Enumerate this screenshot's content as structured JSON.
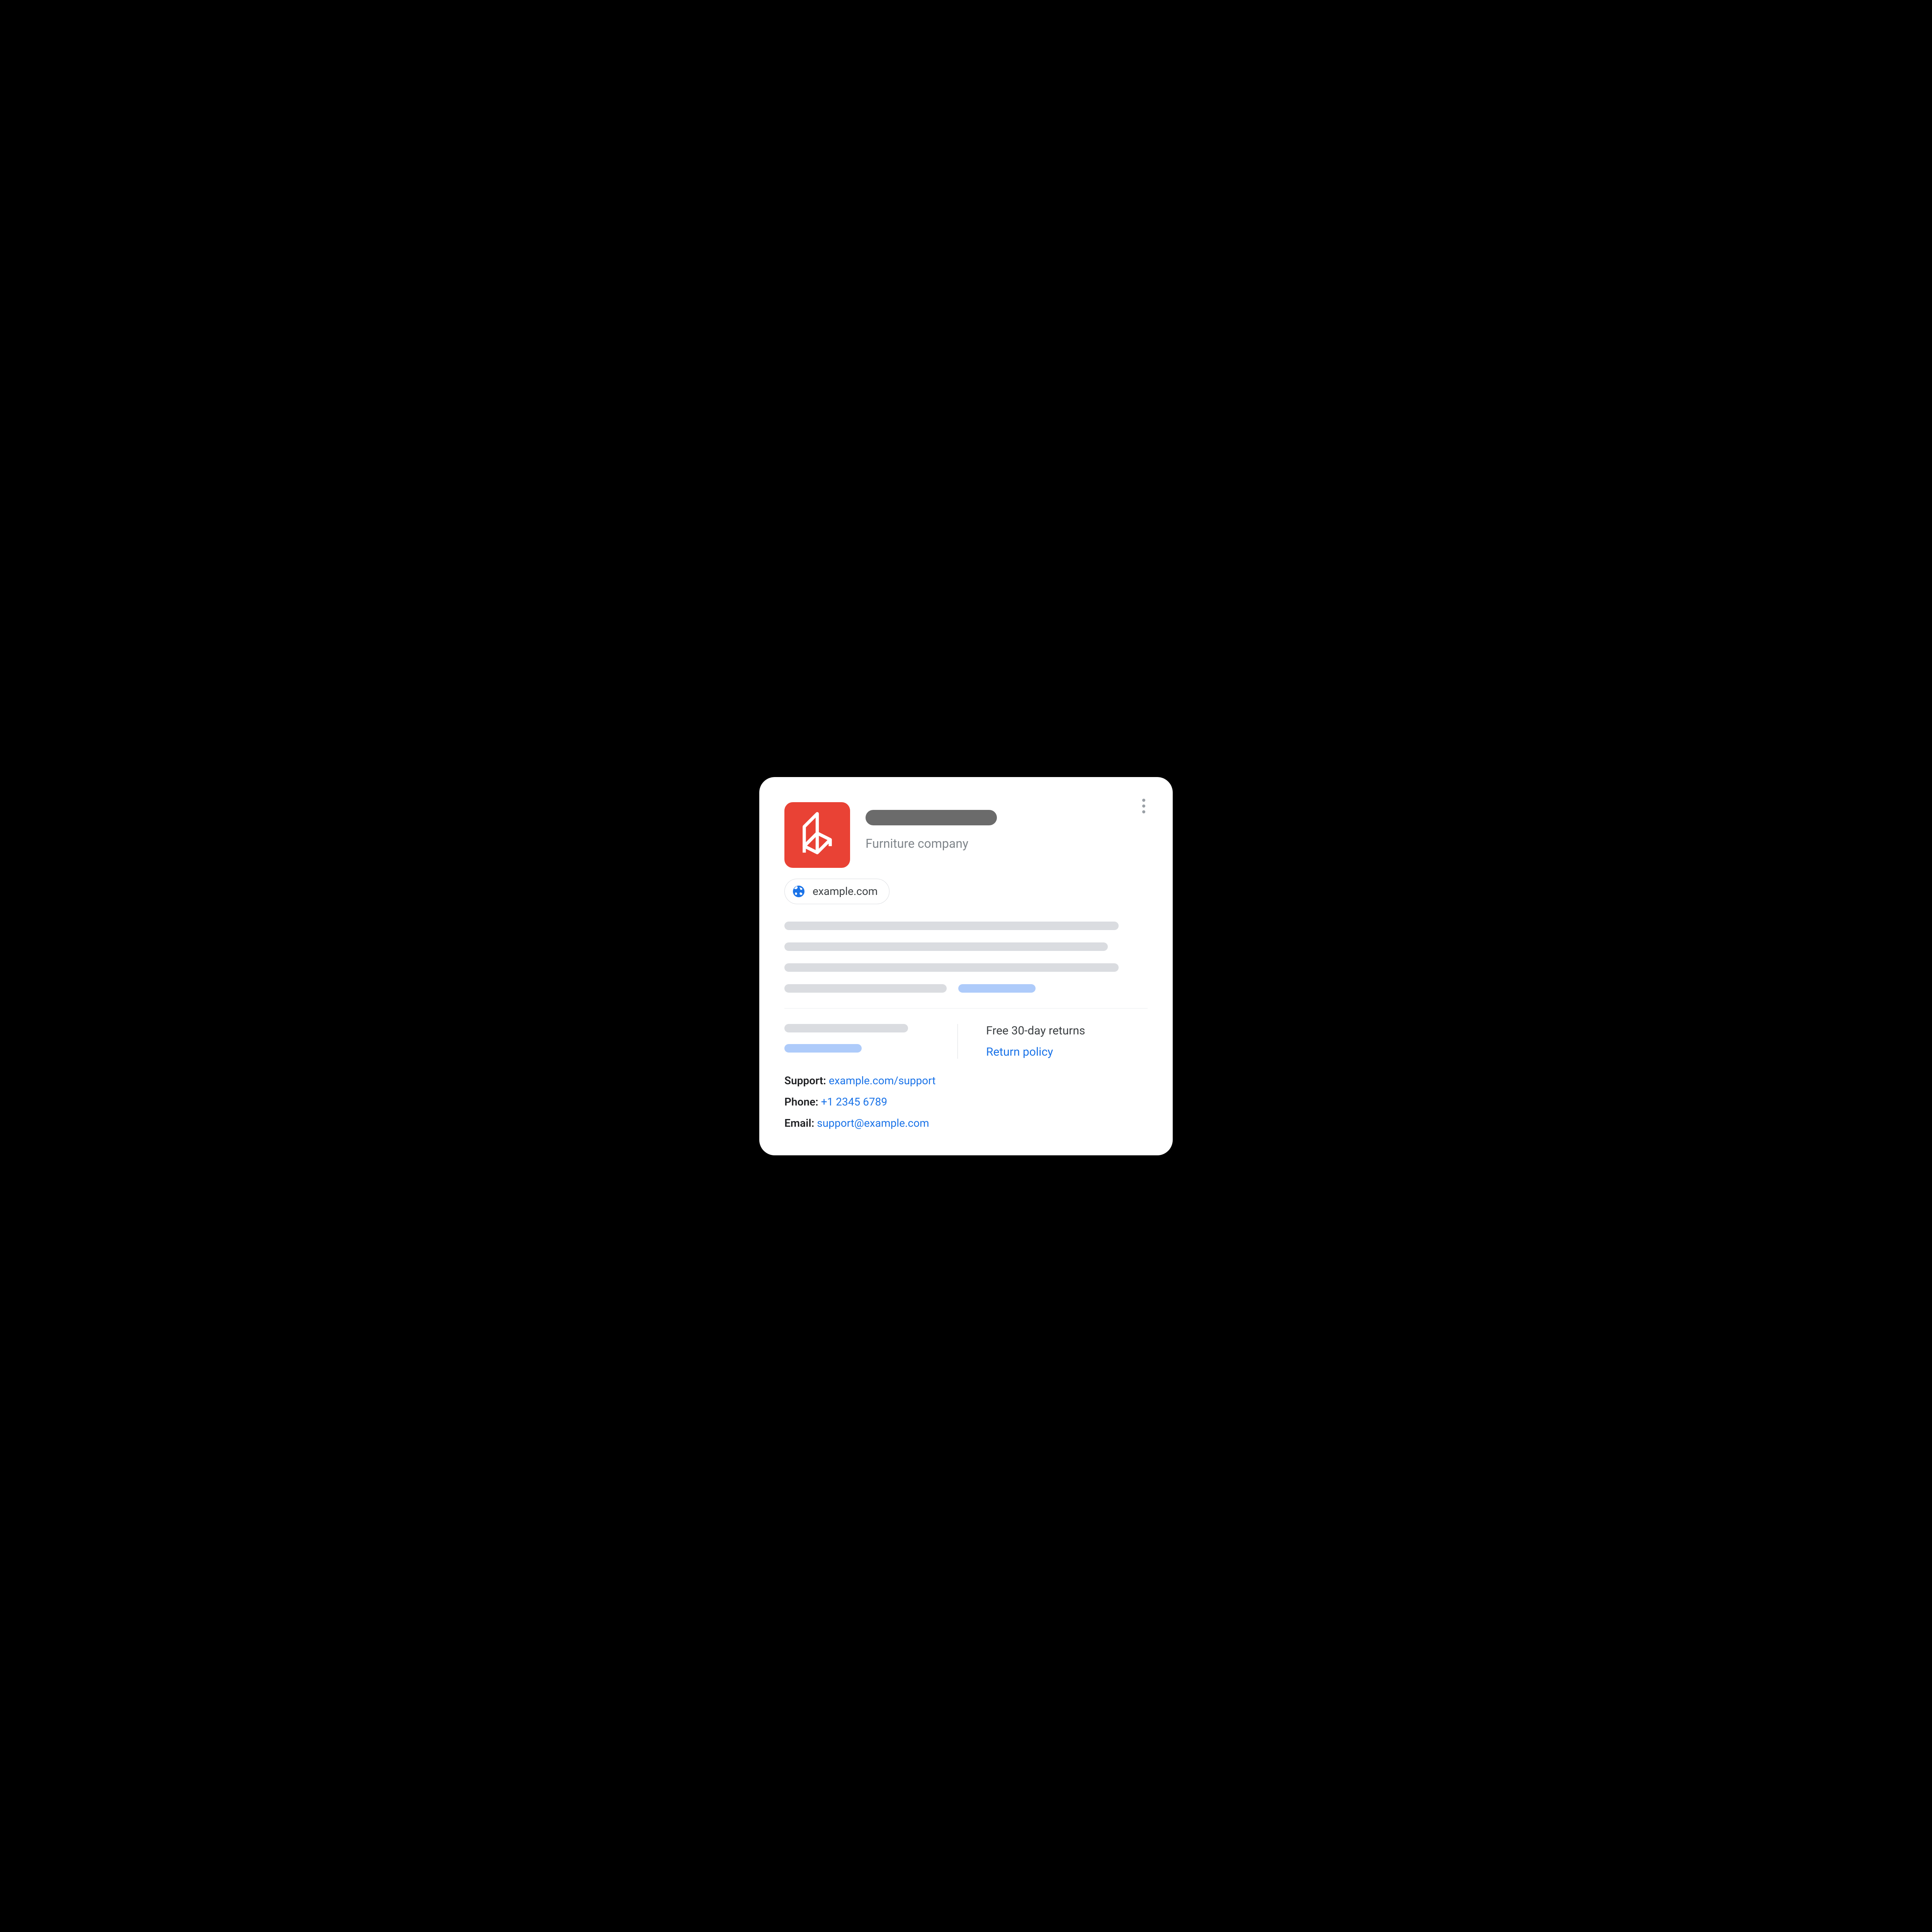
{
  "header": {
    "subtitle": "Furniture company"
  },
  "chip": {
    "domain": "example.com"
  },
  "returns": {
    "line": "Free 30-day returns",
    "policy_link": "Return policy"
  },
  "contact": {
    "support_label": "Support:",
    "support_value": "example.com/support",
    "phone_label": "Phone:",
    "phone_value": "+1 2345 6789",
    "email_label": "Email:",
    "email_value": "support@example.com"
  },
  "colors": {
    "logo_bg": "#E94235",
    "link": "#1a73e8",
    "placeholder_blue": "#aecbfa",
    "placeholder_grey": "#dadce0"
  }
}
